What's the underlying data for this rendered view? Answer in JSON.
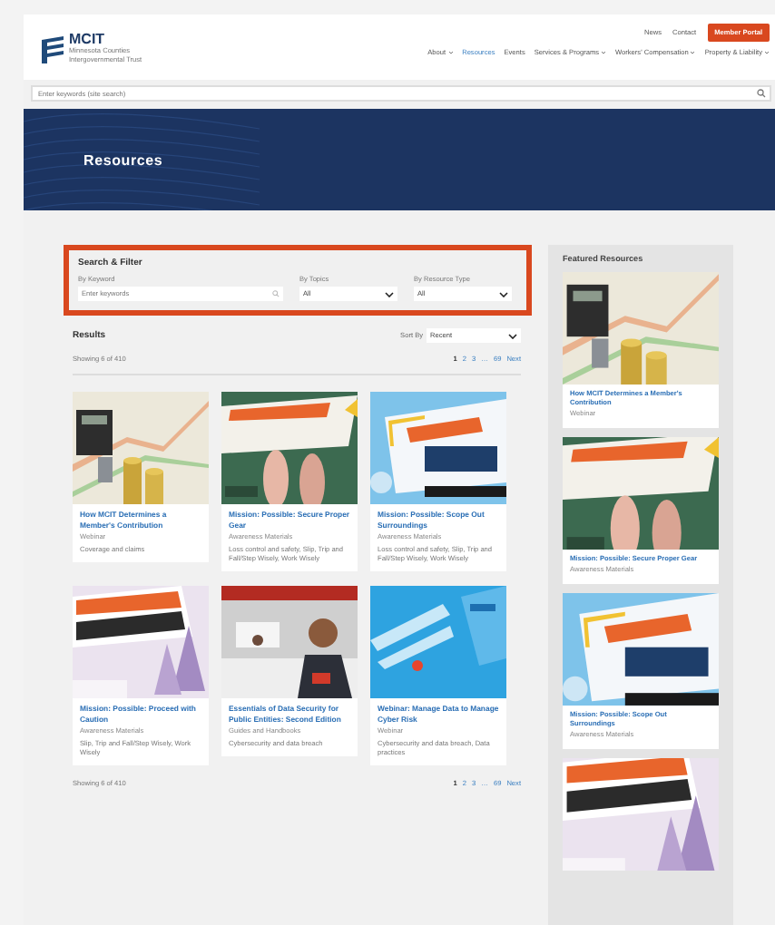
{
  "header": {
    "logo": {
      "name": "MCIT",
      "tagline": "Minnesota Counties Intergovernmental Trust"
    },
    "top_links": [
      "News",
      "Contact"
    ],
    "member_button": "Member Portal",
    "nav": [
      {
        "label": "About",
        "dropdown": true,
        "selected": false
      },
      {
        "label": "Resources",
        "dropdown": false,
        "selected": true
      },
      {
        "label": "Events",
        "dropdown": false,
        "selected": false
      },
      {
        "label": "Services & Programs",
        "dropdown": true,
        "selected": false
      },
      {
        "label": "Workers' Compensation",
        "dropdown": true,
        "selected": false
      },
      {
        "label": "Property & Liability",
        "dropdown": true,
        "selected": false
      }
    ]
  },
  "site_search": {
    "placeholder": "Enter keywords (site search)"
  },
  "banner": {
    "title": "Resources"
  },
  "filter": {
    "highlighted": true,
    "title": "Search & Filter",
    "keyword": {
      "label": "By Keyword",
      "placeholder": "Enter keywords"
    },
    "topics": {
      "label": "By Topics",
      "value": "All"
    },
    "resource_type": {
      "label": "By Resource Type",
      "value": "All"
    }
  },
  "results": {
    "title": "Results",
    "sort_label": "Sort By",
    "sort_value": "Recent",
    "count": "Showing 6 of 410",
    "pages": [
      {
        "label": "1",
        "selected": true
      },
      {
        "label": "2",
        "selected": false
      },
      {
        "label": "3",
        "selected": false
      },
      {
        "label": "…",
        "selected": false
      },
      {
        "label": "69",
        "selected": false
      },
      {
        "label": "Next",
        "selected": false
      }
    ],
    "cards": [
      {
        "title": "How MCIT Determines a Member's Contribution",
        "type": "Webinar",
        "tags": "Coverage and claims"
      },
      {
        "title": "Mission: Possible: Secure Proper Gear",
        "type": "Awareness Materials",
        "tags": "Loss control and safety, Slip, Trip and Fall/Step Wisely, Work Wisely"
      },
      {
        "title": "Mission: Possible: Scope Out Surroundings",
        "type": "Awareness Materials",
        "tags": "Loss control and safety, Slip, Trip and Fall/Step Wisely, Work Wisely"
      },
      {
        "title": "Mission: Possible: Proceed with Caution",
        "type": "Awareness Materials",
        "tags": "Slip, Trip and Fall/Step Wisely, Work Wisely"
      },
      {
        "title": "Essentials of Data Security for Public Entities: Second Edition",
        "type": "Guides and Handbooks",
        "tags": "Cybersecurity and data breach"
      },
      {
        "title": "Webinar: Manage Data to Manage Cyber Risk",
        "type": "Webinar",
        "tags": "Cybersecurity and data breach, Data practices"
      }
    ],
    "bottom_count": "Showing 6 of 410",
    "bottom_pages": [
      {
        "label": "1",
        "selected": true
      },
      {
        "label": "2",
        "selected": false
      },
      {
        "label": "3",
        "selected": false
      },
      {
        "label": "…",
        "selected": false
      },
      {
        "label": "69",
        "selected": false
      },
      {
        "label": "Next",
        "selected": false
      }
    ]
  },
  "featured": {
    "title": "Featured Resources",
    "items": [
      {
        "kind": "card",
        "title": "How MCIT Determines a Member's Contribution",
        "type": "Webinar"
      },
      {
        "kind": "card",
        "title": "Mission: Possible: Secure Proper Gear",
        "type": "Awareness Materials"
      },
      {
        "kind": "card",
        "title": "Mission: Possible: Scope Out Surroundings",
        "type": "Awareness Materials"
      },
      {
        "kind": "picture"
      }
    ]
  }
}
